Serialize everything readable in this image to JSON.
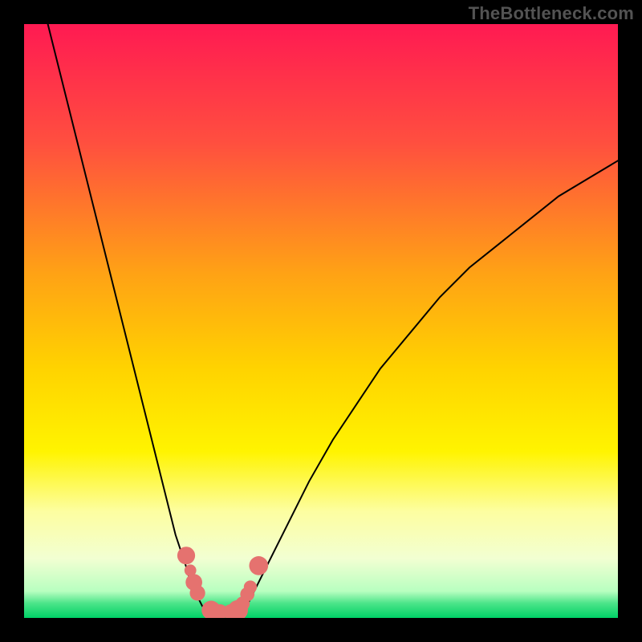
{
  "watermark": "TheBottleneck.com",
  "chart_data": {
    "type": "line",
    "title": "",
    "xlabel": "",
    "ylabel": "",
    "xlim": [
      0,
      100
    ],
    "ylim": [
      0,
      100
    ],
    "grid": false,
    "legend": false,
    "series": [
      {
        "name": "left-branch",
        "x": [
          4,
          6,
          8,
          10,
          12,
          14,
          16,
          18,
          20,
          22,
          24,
          25.5,
          26.5,
          27.5,
          28,
          29,
          30,
          31
        ],
        "y": [
          100,
          92,
          84,
          76,
          68,
          60,
          52,
          44,
          36,
          28,
          20,
          14,
          11,
          8,
          6,
          4,
          2,
          1
        ]
      },
      {
        "name": "right-branch",
        "x": [
          37,
          38,
          40,
          42,
          45,
          48,
          52,
          56,
          60,
          65,
          70,
          75,
          80,
          85,
          90,
          95,
          100
        ],
        "y": [
          1,
          3,
          7,
          11,
          17,
          23,
          30,
          36,
          42,
          48,
          54,
          59,
          63,
          67,
          71,
          74,
          77
        ]
      }
    ],
    "annotations": {
      "type": "scatter",
      "name": "marker-dots",
      "color": "#e5726f",
      "points": [
        {
          "x": 27.3,
          "y": 10.5,
          "r": 1.5
        },
        {
          "x": 28.0,
          "y": 8.0,
          "r": 1.0
        },
        {
          "x": 28.6,
          "y": 6.0,
          "r": 1.4
        },
        {
          "x": 29.2,
          "y": 4.2,
          "r": 1.3
        },
        {
          "x": 31.5,
          "y": 1.3,
          "r": 1.6
        },
        {
          "x": 33.0,
          "y": 1.0,
          "r": 1.3
        },
        {
          "x": 34.8,
          "y": 1.0,
          "r": 1.3
        },
        {
          "x": 36.0,
          "y": 1.3,
          "r": 1.7
        },
        {
          "x": 36.8,
          "y": 2.4,
          "r": 1.2
        },
        {
          "x": 37.6,
          "y": 4.0,
          "r": 1.2
        },
        {
          "x": 38.1,
          "y": 5.2,
          "r": 1.1
        },
        {
          "x": 39.5,
          "y": 8.8,
          "r": 1.6
        }
      ]
    },
    "background": {
      "stops": [
        {
          "offset": 0.0,
          "color": "#ff1a52"
        },
        {
          "offset": 0.2,
          "color": "#ff4f3f"
        },
        {
          "offset": 0.42,
          "color": "#ffa215"
        },
        {
          "offset": 0.58,
          "color": "#ffd300"
        },
        {
          "offset": 0.72,
          "color": "#fff400"
        },
        {
          "offset": 0.82,
          "color": "#fdfea0"
        },
        {
          "offset": 0.9,
          "color": "#f2ffd2"
        },
        {
          "offset": 0.955,
          "color": "#b8ffc0"
        },
        {
          "offset": 0.975,
          "color": "#4de58a"
        },
        {
          "offset": 1.0,
          "color": "#00d166"
        }
      ]
    }
  }
}
